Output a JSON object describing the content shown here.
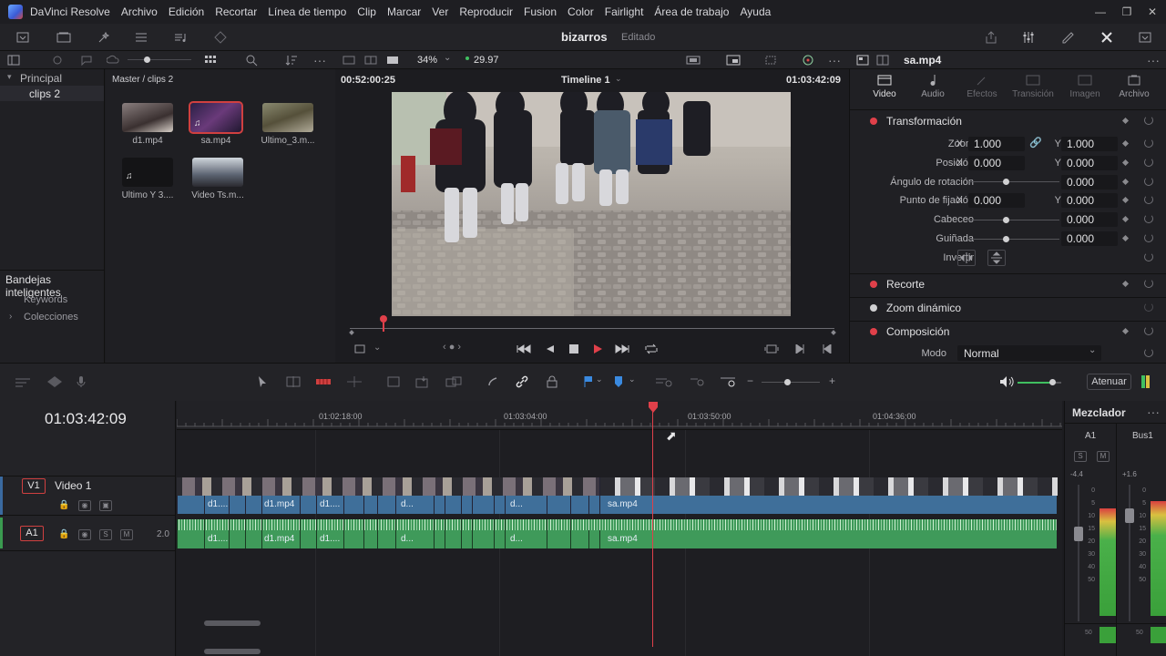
{
  "app": {
    "name": "DaVinci Resolve",
    "menu": [
      "Archivo",
      "Edición",
      "Recortar",
      "Línea de tiempo",
      "Clip",
      "Marcar",
      "Ver",
      "Reproducir",
      "Fusion",
      "Color",
      "Fairlight",
      "Área de trabajo",
      "Ayuda"
    ]
  },
  "project": {
    "title": "bizarros",
    "status": "Editado"
  },
  "subbar": {
    "zoom": "34%",
    "fps": "29.97"
  },
  "bins": {
    "root": "Principal",
    "selected": "clips 2",
    "smart_bins_title": "Bandejas inteligentes",
    "smart_bins": [
      "Keywords",
      "Colecciones"
    ]
  },
  "media_pool": {
    "path": "Master / clips 2",
    "clips": [
      {
        "name": "d1.mp4",
        "type": "video"
      },
      {
        "name": "sa.mp4",
        "type": "video",
        "selected": true
      },
      {
        "name": "Ultimo_3.m...",
        "type": "video"
      },
      {
        "name": "Ultimo Y 3....",
        "type": "audio"
      },
      {
        "name": "Video Ts.m...",
        "type": "video"
      }
    ]
  },
  "viewer": {
    "source_tc": "00:52:00:25",
    "timeline_name": "Timeline 1",
    "record_tc": "01:03:42:09",
    "scrub_progress": 0.07
  },
  "inspector": {
    "clip_name": "sa.mp4",
    "tabs": [
      "Video",
      "Audio",
      "Efectos",
      "Transición",
      "Imagen",
      "Archivo"
    ],
    "active_tab": "Video",
    "transform_title": "Transformación",
    "params": {
      "zoom_label": "Zoom",
      "zoom_x": "1.000",
      "zoom_y": "1.000",
      "position_label": "Posición",
      "position_x": "0.000",
      "position_y": "0.000",
      "rotation_label": "Ángulo de rotación",
      "rotation": "0.000",
      "anchor_label": "Punto de fijación",
      "anchor_x": "0.000",
      "anchor_y": "0.000",
      "pitch_label": "Cabeceo",
      "pitch": "0.000",
      "yaw_label": "Guiñada",
      "yaw": "0.000",
      "flip_label": "Invertir",
      "x_axis": "X",
      "y_axis": "Y"
    },
    "sections": [
      "Recorte",
      "Zoom dinámico",
      "Composición"
    ],
    "mode_label": "Modo",
    "mode_value": "Normal"
  },
  "timeline": {
    "timecode": "01:03:42:09",
    "ruler": [
      "01:02:18:00",
      "01:03:04:00",
      "01:03:50:00",
      "01:04:36:00"
    ],
    "video_track": {
      "id": "V1",
      "name": "Video 1"
    },
    "audio_track": {
      "id": "A1",
      "level": "2.0",
      "solo": "S",
      "mute": "M"
    },
    "video_clip_labels": [
      "d1....",
      "d1.mp4",
      "d1....",
      "d...",
      "d...",
      "sa.mp4"
    ],
    "audio_clip_labels": [
      "d1....",
      "d1.mp4",
      "d1....",
      "d...",
      "d...",
      "sa.mp4"
    ],
    "mute_button": "Atenuar"
  },
  "mixer": {
    "title": "Mezclador",
    "channels": [
      {
        "name": "A1",
        "gain": "-4.4",
        "s": "S",
        "m": "M"
      },
      {
        "name": "Bus1",
        "gain": "+1.6"
      }
    ],
    "scale": [
      "0",
      "5",
      "10",
      "15",
      "20",
      "30",
      "40",
      "50",
      "50"
    ]
  },
  "colors": {
    "accent_red": "#e0404a",
    "video_clip": "#3f6f9a",
    "audio_clip": "#3f9a5a",
    "playhead": "#e0404a"
  }
}
